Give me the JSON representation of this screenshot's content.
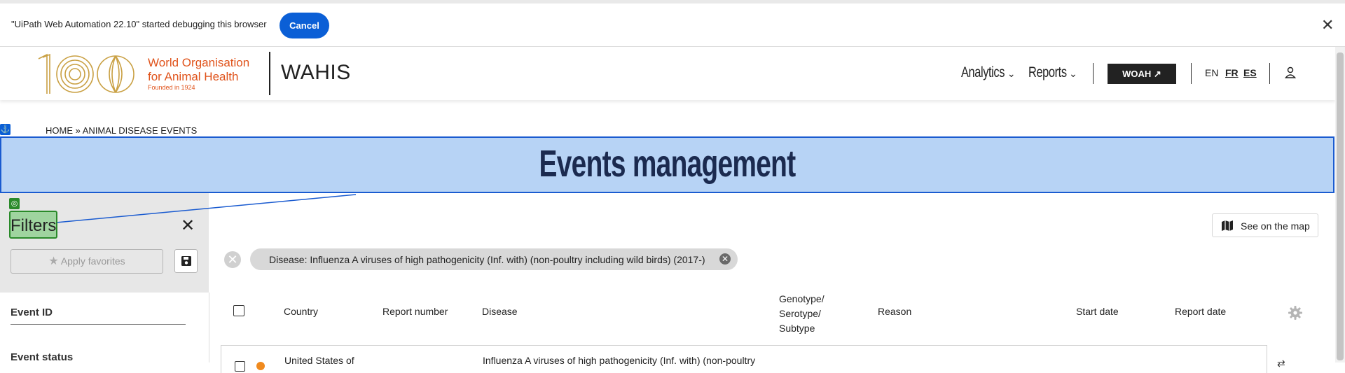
{
  "debug_bar": {
    "message": "\"UiPath Web Automation 22.10\" started debugging this browser",
    "cancel_label": "Cancel",
    "close_glyph": "✕"
  },
  "header": {
    "org_line1": "World Organisation",
    "org_line2": "for Animal Health",
    "founded": "Founded in 1924",
    "app_name": "WAHIS",
    "nav": [
      {
        "label": "Analytics"
      },
      {
        "label": "Reports"
      }
    ],
    "woah_label": "WOAH ↗",
    "languages": [
      "EN",
      "FR",
      "ES"
    ]
  },
  "breadcrumb": {
    "home": "HOME",
    "separator": "»",
    "current": "ANIMAL DISEASE EVENTS"
  },
  "anchor_badge": "⚓",
  "page_title": "Events management",
  "filters": {
    "title": "Filters",
    "close_glyph": "✕",
    "apply_favorites_label": "Apply favorites",
    "fields": {
      "event_id_label": "Event ID",
      "event_status_label": "Event status"
    }
  },
  "main": {
    "see_on_map_label": "See on the map",
    "active_filter_chip": "Disease: Influenza A viruses of high pathogenicity (Inf. with) (non-poultry including wild birds) (2017-)",
    "clear_filters_glyph": "✕",
    "chip_remove_glyph": "✕"
  },
  "table": {
    "columns": {
      "country": "Country",
      "report_number": "Report number",
      "disease": "Disease",
      "genotype_line1": "Genotype/",
      "genotype_line2": "Serotype/",
      "genotype_line3": "Subtype",
      "reason": "Reason",
      "start_date": "Start date",
      "report_date": "Report date"
    },
    "rows": [
      {
        "country": "United States of",
        "disease": "Influenza A viruses of high pathogenicity (Inf. with) (non-poultry"
      }
    ]
  },
  "colors": {
    "accent_blue": "#0b5fd6",
    "highlight_blue": "#b7d3f5",
    "highlight_green": "#9fd49f",
    "woah_orange": "#e0531b",
    "logo_gold": "#c9a043",
    "title_navy": "#1b2a4f"
  }
}
